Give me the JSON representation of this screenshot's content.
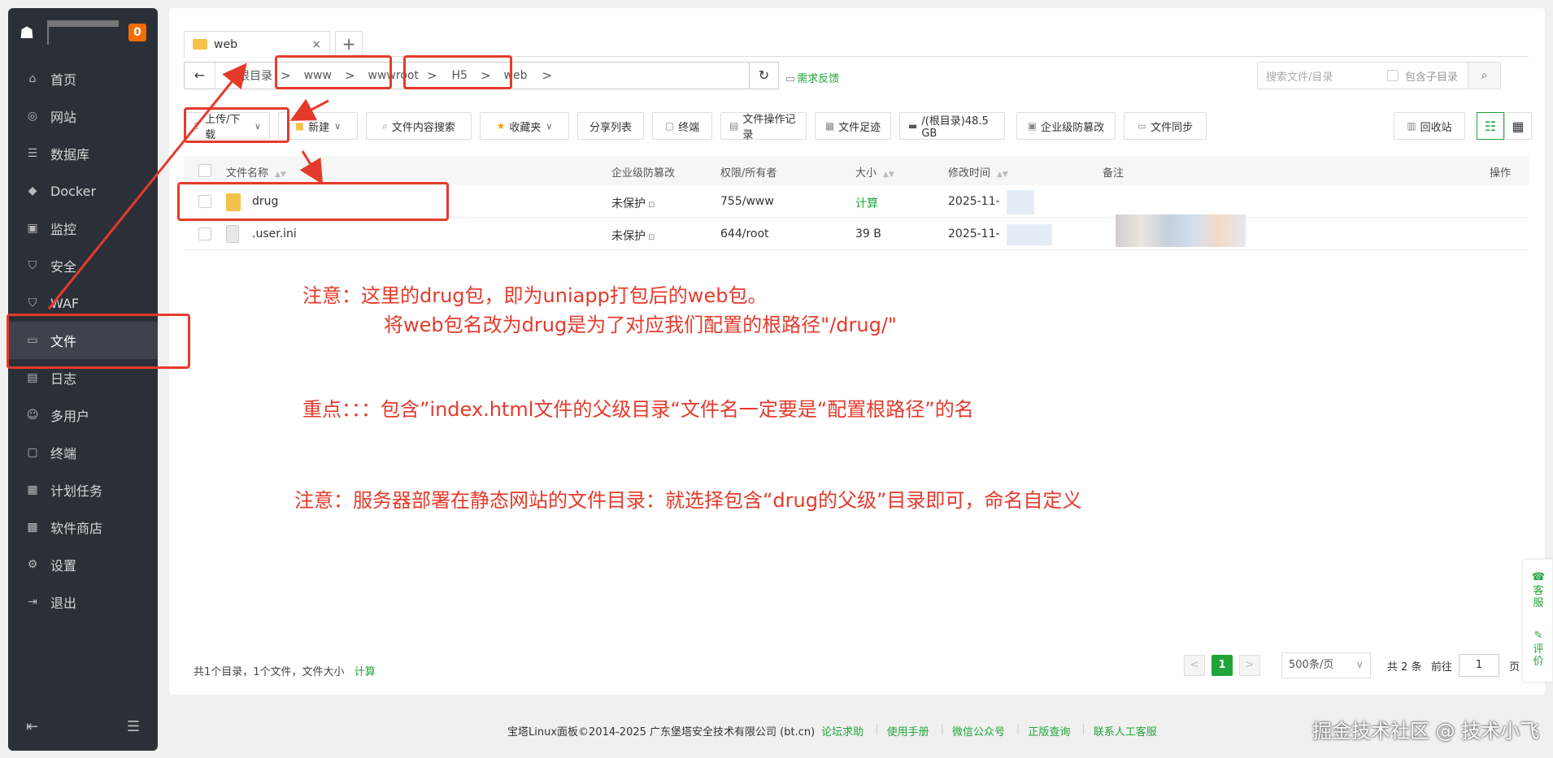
{
  "sidebar": {
    "badge": "0",
    "items": [
      {
        "label": "首页",
        "icon": "home-icon",
        "glyph": "⌂"
      },
      {
        "label": "网站",
        "icon": "globe-icon",
        "glyph": "◎"
      },
      {
        "label": "数据库",
        "icon": "database-icon",
        "glyph": "☰"
      },
      {
        "label": "Docker",
        "icon": "docker-icon",
        "glyph": "◆"
      },
      {
        "label": "监控",
        "icon": "monitor-icon",
        "glyph": "▣"
      },
      {
        "label": "安全",
        "icon": "shield-icon",
        "glyph": "⛉"
      },
      {
        "label": "WAF",
        "icon": "waf-icon",
        "glyph": "⛉"
      },
      {
        "label": "文件",
        "icon": "folder-icon",
        "glyph": "▭"
      },
      {
        "label": "日志",
        "icon": "log-icon",
        "glyph": "▤"
      },
      {
        "label": "多用户",
        "icon": "users-icon",
        "glyph": "☺"
      },
      {
        "label": "终端",
        "icon": "terminal-icon",
        "glyph": "▢"
      },
      {
        "label": "计划任务",
        "icon": "calendar-icon",
        "glyph": "▦"
      },
      {
        "label": "软件商店",
        "icon": "store-icon",
        "glyph": "▩"
      },
      {
        "label": "设置",
        "icon": "gear-icon",
        "glyph": "⚙"
      },
      {
        "label": "退出",
        "icon": "logout-icon",
        "glyph": "⇥"
      }
    ]
  },
  "tab": {
    "label": "web",
    "close": "×",
    "add": "+"
  },
  "path": {
    "back": "←",
    "crumbs": [
      "根目录",
      "www",
      "wwwroot",
      "H5",
      "web"
    ],
    "sep": ">",
    "refresh": "↻",
    "feedback": "需求反馈"
  },
  "search": {
    "placeholder": "搜索文件/目录",
    "include_sub": "包含子目录"
  },
  "toolbar": {
    "upload": "上传/下载",
    "new": "新建",
    "content_search": "文件内容搜索",
    "favorites": "收藏夹",
    "share_list": "分享列表",
    "terminal": "终端",
    "op_log": "文件操作记录",
    "footprint": "文件足迹",
    "disk": "/(根目录)48.5 GB",
    "tamper": "企业级防篡改",
    "sync": "文件同步",
    "recycle": "回收站"
  },
  "table": {
    "headers": {
      "name": "文件名称",
      "tamper": "企业级防篡改",
      "perm": "权限/所有者",
      "size": "大小",
      "mtime": "修改时间",
      "remark": "备注",
      "ops": "操作"
    },
    "rows": [
      {
        "name": "drug",
        "tamper": "未保护",
        "perm": "755/www",
        "size": "计算",
        "mtime": "2025-11-"
      },
      {
        "name": ".user.ini",
        "tamper": "未保护",
        "perm": "644/root",
        "size": "39 B",
        "mtime": "2025-11-"
      }
    ]
  },
  "footer_stats": {
    "text": "共1个目录，1个文件，文件大小",
    "calc": "计算"
  },
  "pager": {
    "prev": "<",
    "current": "1",
    "next": ">",
    "page_size": "500条/页",
    "total": "共 2 条",
    "goto": "前往",
    "goto_value": "1",
    "page_unit": "页"
  },
  "float_side": {
    "service": "客服",
    "review": "评价"
  },
  "copyright": {
    "text": "宝塔Linux面板©2014-2025 广东堡塔安全技术有限公司 (bt.cn)",
    "links": [
      "论坛求助",
      "使用手册",
      "微信公众号",
      "正版查询",
      "联系人工客服"
    ]
  },
  "watermark": "掘金技术社区 @ 技术小飞",
  "annotations": {
    "note1_line1": "注意：这里的drug包，即为uniapp打包后的web包。",
    "note1_line2": "将web包名改为drug是为了对应我们配置的根路径\"/drug/\"",
    "note2": "重点：：：包含”index.html文件的父级目录“文件名一定要是“配置根路径”的名",
    "note3": "注意：服务器部署在静态网站的文件目录：就选择包含“drug的父级”目录即可，命名自定义"
  },
  "colors": {
    "accent": "#20a53a",
    "annotation": "#e53a2b",
    "sidebar_bg": "#2b3038"
  }
}
